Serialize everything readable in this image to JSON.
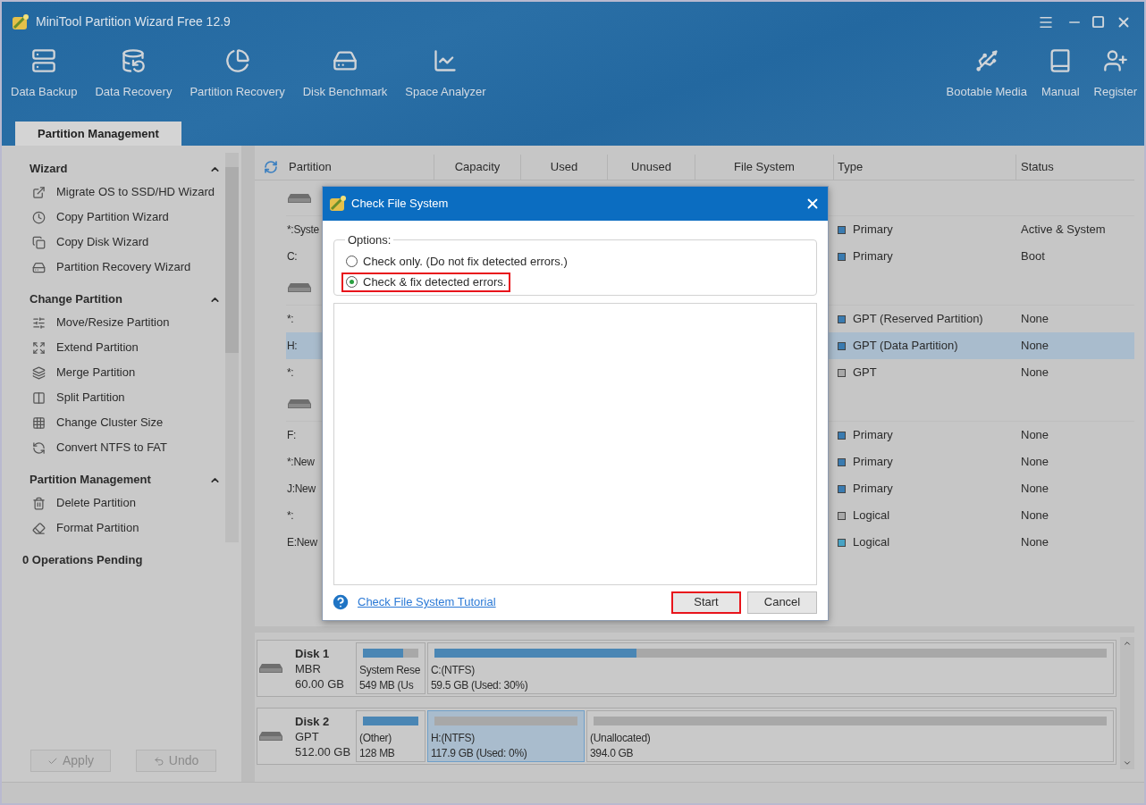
{
  "window": {
    "title": "MiniTool Partition Wizard Free 12.9"
  },
  "toolbar": {
    "left": [
      {
        "label": "Data Backup"
      },
      {
        "label": "Data Recovery"
      },
      {
        "label": "Partition Recovery"
      },
      {
        "label": "Disk Benchmark"
      },
      {
        "label": "Space Analyzer"
      }
    ],
    "right": [
      {
        "label": "Bootable Media"
      },
      {
        "label": "Manual"
      },
      {
        "label": "Register"
      }
    ]
  },
  "tabs": [
    {
      "label": "Partition Management",
      "selected": true
    }
  ],
  "sidebar": {
    "sections": [
      {
        "title": "Wizard",
        "expanded": true,
        "items": [
          {
            "label": "Migrate OS to SSD/HD Wizard"
          },
          {
            "label": "Copy Partition Wizard"
          },
          {
            "label": "Copy Disk Wizard"
          },
          {
            "label": "Partition Recovery Wizard"
          }
        ]
      },
      {
        "title": "Change Partition",
        "expanded": true,
        "items": [
          {
            "label": "Move/Resize Partition"
          },
          {
            "label": "Extend Partition"
          },
          {
            "label": "Merge Partition"
          },
          {
            "label": "Split Partition"
          },
          {
            "label": "Change Cluster Size"
          },
          {
            "label": "Convert NTFS to FAT"
          }
        ]
      },
      {
        "title": "Partition Management",
        "expanded": true,
        "items": [
          {
            "label": "Delete Partition"
          },
          {
            "label": "Format Partition"
          }
        ]
      }
    ],
    "pending": "0 Operations Pending",
    "buttons": [
      {
        "label": "Apply",
        "disabled": true
      },
      {
        "label": "Undo",
        "disabled": true
      }
    ]
  },
  "table": {
    "columns": [
      "Partition",
      "Capacity",
      "Used",
      "Unused",
      "File System",
      "Type",
      "Status"
    ],
    "rows": [
      {
        "kind": "disk"
      },
      {
        "kind": "partition",
        "partition": "*:Syste",
        "type": "Primary",
        "color": "#3a7bb0",
        "status": "Active & System",
        "selected": false
      },
      {
        "kind": "partition",
        "partition": "C:",
        "type": "Primary",
        "color": "#3a7bb0",
        "status": "Boot",
        "selected": false
      },
      {
        "kind": "disk"
      },
      {
        "kind": "partition",
        "partition": "*:",
        "type": "GPT (Reserved Partition)",
        "color": "#3a7bb0",
        "status": "None",
        "selected": false
      },
      {
        "kind": "partition",
        "partition": "H:",
        "type": "GPT (Data Partition)",
        "color": "#3a7bb0",
        "status": "None",
        "selected": true
      },
      {
        "kind": "partition",
        "partition": "*:",
        "type": "GPT",
        "color": "#a8a8a8",
        "status": "None",
        "selected": false
      },
      {
        "kind": "disk"
      },
      {
        "kind": "partition",
        "partition": "F:",
        "type": "Primary",
        "color": "#3a7bb0",
        "status": "None",
        "selected": false
      },
      {
        "kind": "partition",
        "partition": "*:New",
        "type": "Primary",
        "color": "#3a7bb0",
        "status": "None",
        "selected": false
      },
      {
        "kind": "partition",
        "partition": "J:New",
        "type": "Primary",
        "color": "#3a7bb0",
        "status": "None",
        "selected": false
      },
      {
        "kind": "partition",
        "partition": "*:",
        "type": "Logical",
        "color": "#a8a8a8",
        "status": "None",
        "selected": false
      },
      {
        "kind": "partition",
        "partition": "E:New",
        "type": "Logical",
        "color": "#48a3c4",
        "status": "None",
        "selected": false
      }
    ]
  },
  "disk_map": [
    {
      "name": "Disk 1",
      "scheme": "MBR",
      "size": "60.00 GB",
      "partitions": [
        {
          "label": "System Rese",
          "detail": "549 MB (Us",
          "level": 0.72,
          "selected": false
        },
        {
          "label": "C:(NTFS)",
          "detail": "59.5 GB (Used: 30%)",
          "level": 0.3,
          "selected": false
        }
      ]
    },
    {
      "name": "Disk 2",
      "scheme": "GPT",
      "size": "512.00 GB",
      "partitions": [
        {
          "label": "(Other)",
          "detail": "128 MB",
          "level": 1,
          "selected": false
        },
        {
          "label": "H:(NTFS)",
          "detail": "117.9 GB (Used: 0%)",
          "level": 0,
          "selected": true
        },
        {
          "label": "(Unallocated)",
          "detail": "394.0 GB",
          "level": 0,
          "selected": false
        }
      ]
    }
  ],
  "dialog": {
    "title": "Check File System",
    "group": "Options:",
    "options": [
      {
        "label": "Check only. (Do not fix detected errors.)",
        "selected": false,
        "highlighted": false
      },
      {
        "label": "Check & fix detected errors.",
        "selected": true,
        "highlighted": true
      }
    ],
    "link": "Check File System Tutorial",
    "buttons": [
      {
        "label": "Start",
        "highlighted": true
      },
      {
        "label": "Cancel",
        "highlighted": false
      }
    ]
  }
}
